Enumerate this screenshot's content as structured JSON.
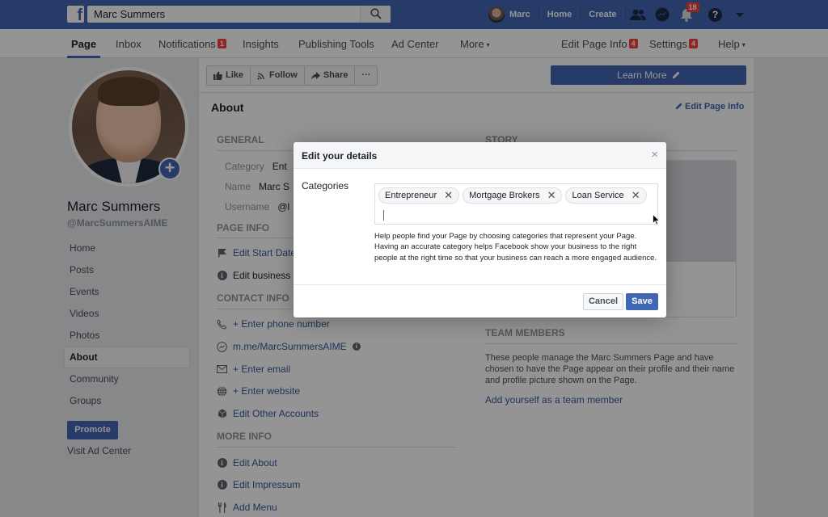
{
  "topbar": {
    "search_value": "Marc Summers",
    "user_name": "Marc",
    "links": [
      "Home",
      "Create"
    ],
    "notifications_count": "18",
    "help_glyph": "?",
    "colors": {
      "brand": "#4267b2",
      "badge": "#fa3e3e"
    }
  },
  "pagenav": {
    "items": [
      {
        "label": "Page",
        "active": true
      },
      {
        "label": "Inbox"
      },
      {
        "label": "Notifications",
        "badge": "1"
      },
      {
        "label": "Insights"
      },
      {
        "label": "Publishing Tools"
      },
      {
        "label": "Ad Center"
      },
      {
        "label": "More",
        "caret": "▾"
      }
    ],
    "right_items": [
      {
        "label": "Edit Page Info",
        "badge": "4"
      },
      {
        "label": "Settings",
        "badge": "4"
      },
      {
        "label": "Help",
        "caret": "▾"
      }
    ]
  },
  "profile": {
    "name": "Marc Summers",
    "handle": "@MarcSummersAIME",
    "add_glyph": "+"
  },
  "sidebar": {
    "items": [
      {
        "label": "Home"
      },
      {
        "label": "Posts"
      },
      {
        "label": "Events"
      },
      {
        "label": "Videos"
      },
      {
        "label": "Photos"
      },
      {
        "label": "About",
        "active": true
      },
      {
        "label": "Community"
      },
      {
        "label": "Groups"
      }
    ],
    "promote_label": "Promote",
    "visit_ad_center": "Visit Ad Center"
  },
  "actions": {
    "like": "Like",
    "follow": "Follow",
    "share": "Share",
    "more": "···",
    "learn_more": "Learn More"
  },
  "about": {
    "title": "About",
    "edit_page_info": "Edit Page Info",
    "general": {
      "header": "GENERAL",
      "category_label": "Category",
      "category_value": "Ent",
      "name_label": "Name",
      "name_value": "Marc S",
      "username_label": "Username",
      "username_value": "@l"
    },
    "page_info": {
      "header": "PAGE INFO",
      "edit_start_date": "Edit Start Date",
      "edit_business": "Edit business"
    },
    "contact_info": {
      "header": "CONTACT INFO",
      "phone": "+ Enter phone number",
      "messenger": "m.me/MarcSummersAIME",
      "email": "+ Enter email",
      "website": "+ Enter website",
      "other_accounts": "Edit Other Accounts"
    },
    "more_info": {
      "header": "MORE INFO",
      "edit_about": "Edit About",
      "edit_impressum": "Edit Impressum",
      "add_menu": "Add Menu"
    },
    "story": {
      "header": "STORY"
    },
    "team": {
      "header": "TEAM MEMBERS",
      "description": "These people manage the Marc Summers Page and have chosen to have the Page appear on their profile and their name and profile picture shown on the Page.",
      "add_link": "Add yourself as a team member"
    }
  },
  "modal": {
    "title": "Edit your details",
    "close_glyph": "×",
    "categories_label": "Categories",
    "tokens": [
      "Entrepreneur",
      "Mortgage Brokers",
      "Loan Service"
    ],
    "token_remove_glyph": "✕",
    "input_value": "",
    "help_text": "Help people find your Page by choosing categories that represent your Page. Having an accurate category helps Facebook show your business to the right people at the right time so that your business can reach a more engaged audience.",
    "cancel_label": "Cancel",
    "save_label": "Save"
  }
}
